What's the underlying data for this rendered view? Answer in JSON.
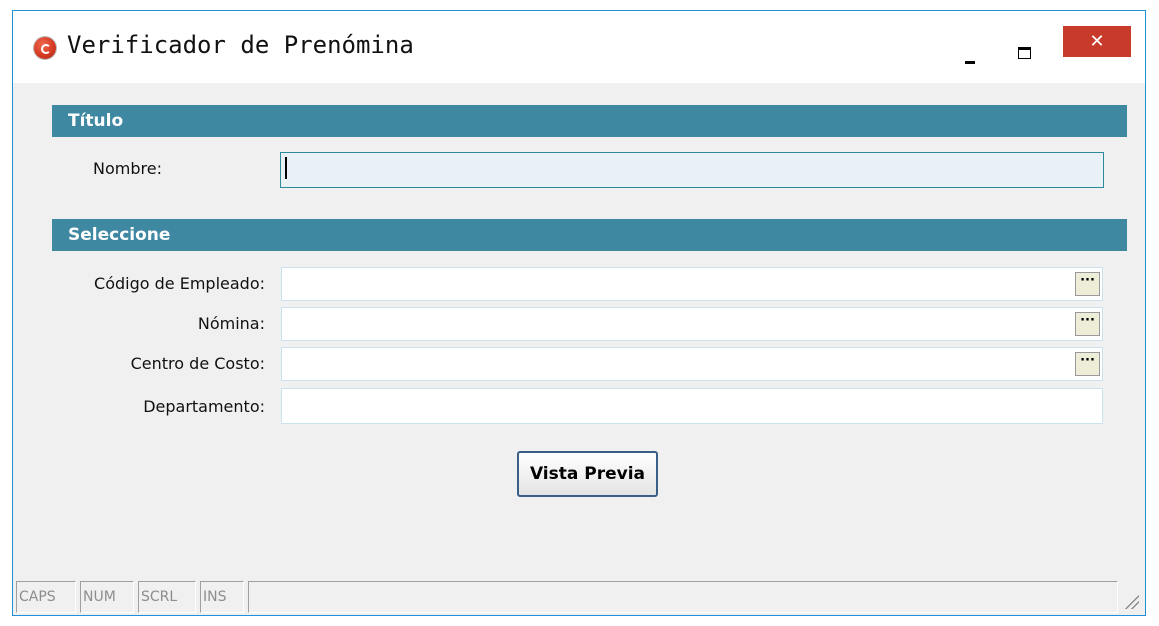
{
  "window": {
    "title": "Verificador de Prenómina",
    "icon": "app-icon",
    "close_glyph": "✕"
  },
  "titulo_section": {
    "header": "Título",
    "nombre_label": "Nombre:",
    "nombre_value": ""
  },
  "seleccione_section": {
    "header": "Seleccione",
    "fields": [
      {
        "label": "Código de Empleado:",
        "value": "",
        "has_lookup": true
      },
      {
        "label": "Nómina:",
        "value": "",
        "has_lookup": true
      },
      {
        "label": "Centro de Costo:",
        "value": "",
        "has_lookup": true
      },
      {
        "label": "Departamento:",
        "value": "",
        "has_lookup": false
      }
    ],
    "lookup_glyph": "···"
  },
  "preview_button_label": "Vista Previa",
  "statusbar": {
    "cells": [
      "CAPS",
      "NUM",
      "SCRL",
      "INS",
      ""
    ]
  },
  "colors": {
    "section_header_bg": "#3f88a2",
    "close_button_bg": "#c83b2b",
    "window_border": "#1e90d8"
  }
}
